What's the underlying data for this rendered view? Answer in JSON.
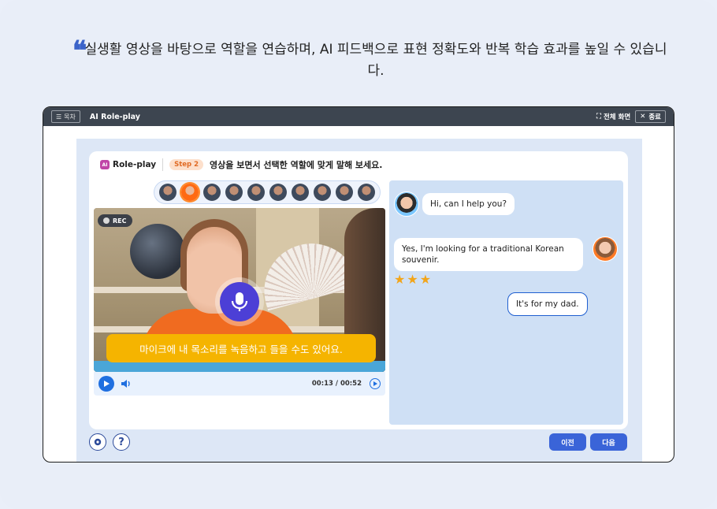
{
  "intro": {
    "quote_mark": "❝",
    "text": "실생활 영상을 바탕으로 역할을 연습하며, AI 피드백으로 표현 정확도와 반복 학습 효과를 높일 수 있습니다."
  },
  "topbar": {
    "menu_label": "목차",
    "app_title": "AI Role-play",
    "fullscreen_label": "전체 화면",
    "close_label": "종료"
  },
  "panel": {
    "ai_badge": "AI",
    "title": "Role-play",
    "step": "Step 2",
    "instruction": "영상을 보면서 선택한 역할에 맞게 말해 보세요.",
    "thumbnail_count": 10,
    "active_thumbnail": 2
  },
  "video": {
    "rec_label": "REC",
    "tooltip": "마이크에 내 목소리를 녹음하고 들을 수도 있어요.",
    "time": "00:13 / 00:52"
  },
  "chat": {
    "messages": [
      {
        "speaker": "clerk",
        "text": "Hi, can I help you?"
      },
      {
        "speaker": "customer",
        "text": "Yes, I'm looking for a traditional Korean souvenir."
      },
      {
        "speaker": "customer",
        "text": "It's for my dad."
      }
    ],
    "rating_stars": 3
  },
  "footer": {
    "settings_icon": "gear-icon",
    "help_label": "?",
    "prev_label": "이전",
    "next_label": "다음"
  },
  "colors": {
    "accent": "#3a64d8",
    "tooltip": "#f5b400",
    "step": "#e06a23"
  }
}
